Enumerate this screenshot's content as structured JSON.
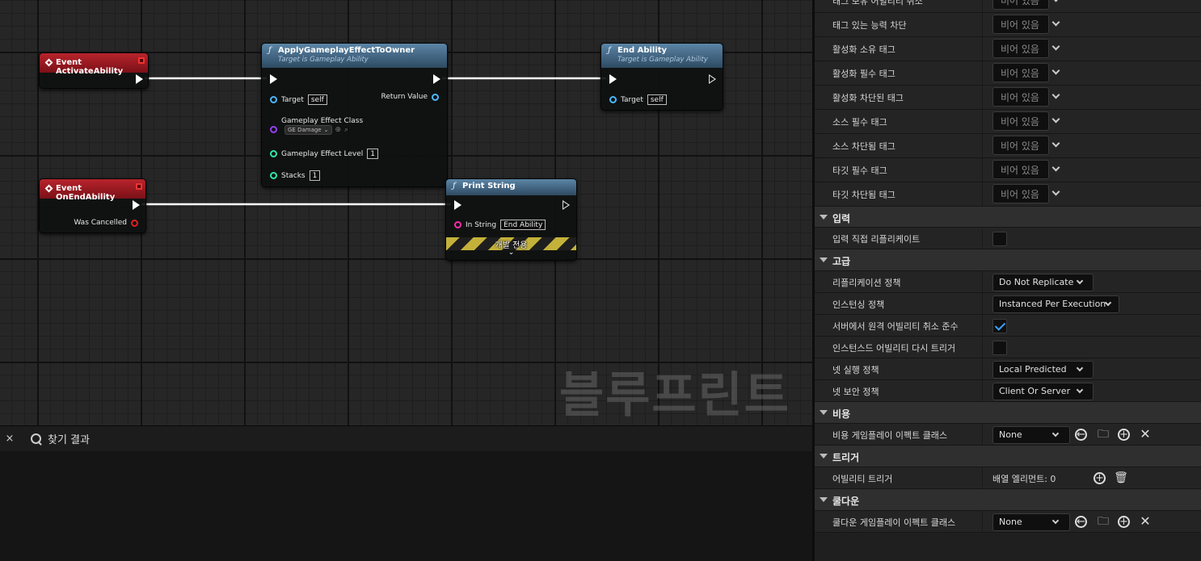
{
  "graph": {
    "watermark": "블루프린트",
    "nodes": {
      "activate": {
        "title": "Event ActivateAbility"
      },
      "apply": {
        "title": "ApplyGameplayEffectToOwner",
        "subtitle": "Target is Gameplay Ability",
        "target_label": "Target",
        "target_value": "self",
        "return_label": "Return Value",
        "class_label": "Gameplay Effect Class",
        "class_value": "GE Damage",
        "level_label": "Gameplay Effect Level",
        "level_value": "1",
        "stacks_label": "Stacks",
        "stacks_value": "1"
      },
      "end": {
        "title": "End Ability",
        "subtitle": "Target is Gameplay Ability",
        "target_label": "Target",
        "target_value": "self"
      },
      "onend": {
        "title": "Event OnEndAbility",
        "cancelled_label": "Was Cancelled"
      },
      "print": {
        "title": "Print String",
        "instring_label": "In String",
        "instring_value": "End Ability",
        "devonly": "개발 전용"
      }
    }
  },
  "find": {
    "close": "×",
    "label": "찾기 결과"
  },
  "details": {
    "empty_value": "비어 있음",
    "tag_rows": [
      "태그 보유 어빌리티 취소",
      "태그 있는 능력 차단",
      "활성화 소유 태그",
      "활성화 필수 태그",
      "활성화 차단된 태그",
      "소스 필수 태그",
      "소스 차단됨 태그",
      "타깃 필수 태그",
      "타깃 차단됨 태그"
    ],
    "categories": {
      "input": "입력",
      "advanced": "고급",
      "cost": "비용",
      "trigger": "트리거",
      "cooldown": "쿨다운"
    },
    "input": {
      "replicate_label": "입력 직접 리플리케이트",
      "replicate_checked": false
    },
    "advanced": {
      "replication_label": "리플리케이션 정책",
      "replication_value": "Do Not Replicate",
      "instancing_label": "인스턴싱 정책",
      "instancing_value": "Instanced Per Execution",
      "server_cancel_label": "서버에서 원격 어빌리티 취소 준수",
      "server_cancel_checked": true,
      "retrigger_label": "인스턴스드 어빌리티 다시 트리거",
      "retrigger_checked": false,
      "net_exec_label": "넷 실행 정책",
      "net_exec_value": "Local Predicted",
      "net_security_label": "넷 보안 정책",
      "net_security_value": "Client Or Server"
    },
    "cost": {
      "label": "비용 게임플레이 이펙트 클래스",
      "value": "None"
    },
    "trigger": {
      "label": "어빌리티 트리거",
      "value": "배열 엘리먼트: 0"
    },
    "cooldown": {
      "label": "쿨다운 게임플레이 이펙트 클래스",
      "value": "None"
    }
  },
  "colors": {
    "event_header": "#a01c24",
    "function_header": "#4a7090",
    "exec_wire": "#ffffff",
    "checkbox_check": "#3ba0ff"
  }
}
